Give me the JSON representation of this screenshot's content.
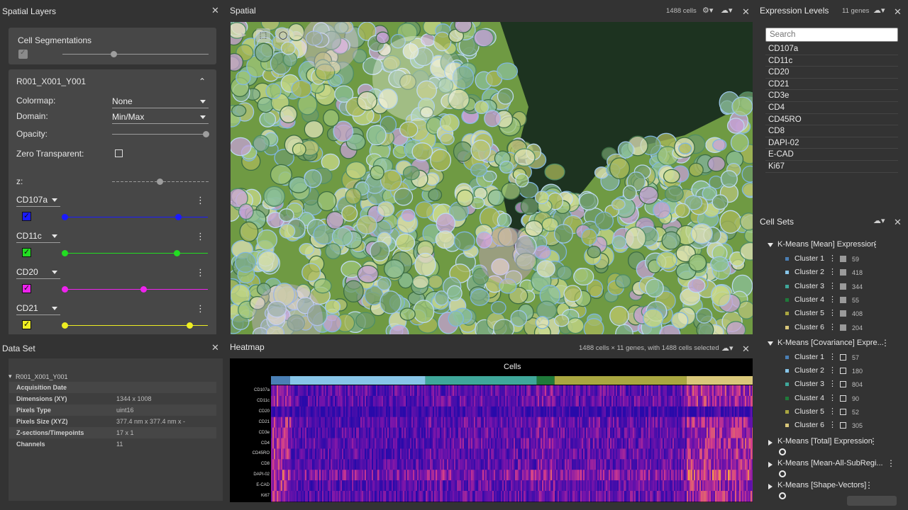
{
  "spatial_layers": {
    "title": "Spatial Layers",
    "cell_segmentations": {
      "label": "Cell Segmentations",
      "opacity": 0.35
    },
    "image_layer": {
      "name": "R001_X001_Y001",
      "colormap_label": "Colormap:",
      "colormap_value": "None",
      "domain_label": "Domain:",
      "domain_value": "Min/Max",
      "opacity_label": "Opacity:",
      "opacity_value": 1.0,
      "zero_transparent_label": "Zero Transparent:",
      "z_label": "z:",
      "z_value": 0.5,
      "channels": [
        {
          "name": "CD107a",
          "color": "#1a1aff",
          "range": [
            0.0,
            0.79
          ]
        },
        {
          "name": "CD11c",
          "color": "#22dd22",
          "range": [
            0.0,
            0.78
          ]
        },
        {
          "name": "CD20",
          "color": "#ee22ee",
          "range": [
            0.0,
            0.55
          ]
        },
        {
          "name": "CD21",
          "color": "#eeee22",
          "range": [
            0.0,
            0.87
          ]
        }
      ]
    }
  },
  "spatial": {
    "title": "Spatial",
    "cell_count": "1488 cells",
    "tools": {
      "pan": "pan-tool-icon",
      "rect": "rect-select-icon",
      "lasso": "lasso-icon"
    }
  },
  "expression_levels": {
    "title": "Expression Levels",
    "gene_count": "11 genes",
    "search_placeholder": "Search",
    "genes": [
      "CD107a",
      "CD11c",
      "CD20",
      "CD21",
      "CD3e",
      "CD4",
      "CD45RO",
      "CD8",
      "DAPI-02",
      "E-CAD",
      "Ki67"
    ]
  },
  "cell_sets": {
    "title": "Cell Sets",
    "groups": [
      {
        "name": "K-Means [Mean] Expression",
        "expanded": true,
        "clusters": [
          {
            "name": "Cluster 1",
            "color": "#4a7fb5",
            "count": "59"
          },
          {
            "name": "Cluster 2",
            "color": "#87c5e8",
            "count": "418"
          },
          {
            "name": "Cluster 3",
            "color": "#3fa79a",
            "count": "344"
          },
          {
            "name": "Cluster 4",
            "color": "#1f7a3a",
            "count": "55"
          },
          {
            "name": "Cluster 5",
            "color": "#a9a640",
            "count": "408"
          },
          {
            "name": "Cluster 6",
            "color": "#d9c77a",
            "count": "204"
          }
        ]
      },
      {
        "name": "K-Means [Covariance] Expre...",
        "expanded": true,
        "clusters": [
          {
            "name": "Cluster 1",
            "color": "#4a7fb5",
            "count": "57"
          },
          {
            "name": "Cluster 2",
            "color": "#87c5e8",
            "count": "180"
          },
          {
            "name": "Cluster 3",
            "color": "#3fa79a",
            "count": "804"
          },
          {
            "name": "Cluster 4",
            "color": "#1f7a3a",
            "count": "90"
          },
          {
            "name": "Cluster 5",
            "color": "#a9a640",
            "count": "52"
          },
          {
            "name": "Cluster 6",
            "color": "#d9c77a",
            "count": "305"
          }
        ]
      },
      {
        "name": "K-Means [Total] Expression",
        "expanded": false
      },
      {
        "name": "K-Means [Mean-All-SubRegi...",
        "expanded": false
      },
      {
        "name": "K-Means [Shape-Vectors]",
        "expanded": false
      }
    ]
  },
  "data_set": {
    "title": "Data Set",
    "name": "R001_X001_Y001",
    "rows": [
      {
        "key": "Acquisition Date",
        "value": ""
      },
      {
        "key": "Dimensions (XY)",
        "value": "1344 x 1008"
      },
      {
        "key": "Pixels Type",
        "value": "uint16"
      },
      {
        "key": "Pixels Size (XYZ)",
        "value": "377.4 nm x 377.4 nm x -"
      },
      {
        "key": "Z-sections/Timepoints",
        "value": "17 x 1"
      },
      {
        "key": "Channels",
        "value": "11"
      }
    ]
  },
  "heatmap": {
    "title": "Heatmap",
    "info": "1488 cells × 11 genes, with 1488 cells selected",
    "axis_title": "Cells",
    "genes": [
      "CD107a",
      "CD11c",
      "CD20",
      "CD21",
      "CD3e",
      "CD4",
      "CD45RO",
      "CD8",
      "DAPI-02",
      "E-CAD",
      "Ki67"
    ]
  },
  "colors": {
    "background": "#333333",
    "card": "#474747",
    "accent_heat_low": "#2a0fa8",
    "accent_heat_high": "#f7a035"
  }
}
